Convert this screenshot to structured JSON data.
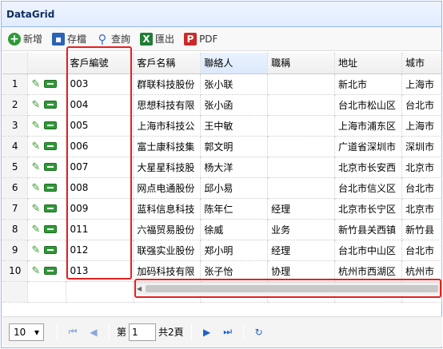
{
  "panel": {
    "title": "DataGrid"
  },
  "toolbar": [
    {
      "label": "新增",
      "icon": "add-icon",
      "glyph": "+"
    },
    {
      "label": "存檔",
      "icon": "save-icon",
      "glyph": "▪"
    },
    {
      "label": "查詢",
      "icon": "search-icon",
      "glyph": "⚲"
    },
    {
      "label": "匯出",
      "icon": "excel-icon",
      "glyph": "X"
    },
    {
      "label": "PDF",
      "icon": "pdf-icon",
      "glyph": "P"
    }
  ],
  "columns": [
    "",
    "",
    "客戶編號",
    "客戶名稱",
    "聯絡人",
    "職稱",
    "地址",
    "城市"
  ],
  "rows": [
    {
      "n": "1",
      "id": "003",
      "name": "群联科技股份",
      "contact": "张小联",
      "title": "",
      "addr": "新北市",
      "city": "上海市"
    },
    {
      "n": "2",
      "id": "004",
      "name": "思想科技有限",
      "contact": "张小函",
      "title": "",
      "addr": "台北市松山区",
      "city": "台北市"
    },
    {
      "n": "3",
      "id": "005",
      "name": "上海市科技公",
      "contact": "王中敏",
      "title": "",
      "addr": "上海市浦东区",
      "city": "上海市"
    },
    {
      "n": "4",
      "id": "006",
      "name": "富士康科技集",
      "contact": "郭文明",
      "title": "",
      "addr": "广道省深圳市",
      "city": "深圳市"
    },
    {
      "n": "5",
      "id": "007",
      "name": "大星星科技股",
      "contact": "杨大洋",
      "title": "",
      "addr": "北京市长安西",
      "city": "北京市"
    },
    {
      "n": "6",
      "id": "008",
      "name": "网点电通股份",
      "contact": "邱小易",
      "title": "",
      "addr": "台北市信义区",
      "city": "台北市"
    },
    {
      "n": "7",
      "id": "009",
      "name": "蓝科信息科技",
      "contact": "陈年仁",
      "title": "经理",
      "addr": "北京市长宁区",
      "city": "北京市"
    },
    {
      "n": "8",
      "id": "011",
      "name": "六福贸易股份",
      "contact": "徐威",
      "title": "业务",
      "addr": "新竹县关西镇",
      "city": "新竹县"
    },
    {
      "n": "9",
      "id": "012",
      "name": "联强实业股份",
      "contact": "郑小明",
      "title": "经理",
      "addr": "台北市中山区",
      "city": "台北市"
    },
    {
      "n": "10",
      "id": "013",
      "name": "加码科技有限",
      "contact": "张子怡",
      "title": "协理",
      "addr": "杭州市西湖区",
      "city": "杭州市"
    }
  ],
  "pager": {
    "page_size": "10",
    "page_prefix": "第",
    "current_page": "1",
    "total_pages_text": "共2頁"
  }
}
